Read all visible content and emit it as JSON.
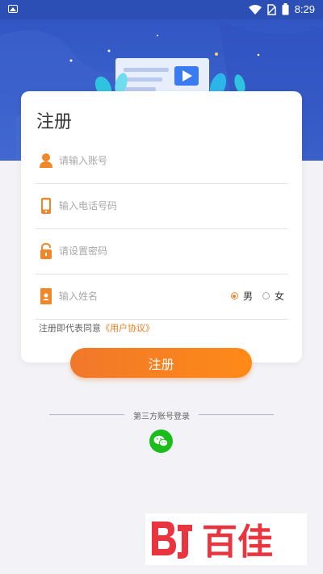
{
  "status_bar": {
    "time": "8:29"
  },
  "form": {
    "title": "注册",
    "account_placeholder": "请输入账号",
    "phone_placeholder": "输入电话号码",
    "password_placeholder": "请设置密码",
    "name_placeholder": "输入姓名",
    "gender_male": "男",
    "gender_female": "女",
    "gender_selected": "男",
    "agreement_prefix": "注册即代表同意",
    "agreement_link": "《用户协议》"
  },
  "register_button": "注册",
  "third_party": {
    "label": "第三方账号登录"
  },
  "watermark_text": "百佳",
  "colors": {
    "primary_blue": "#3156c4",
    "accent_orange": "#f0782a",
    "wechat_green": "#1bbd1b"
  }
}
